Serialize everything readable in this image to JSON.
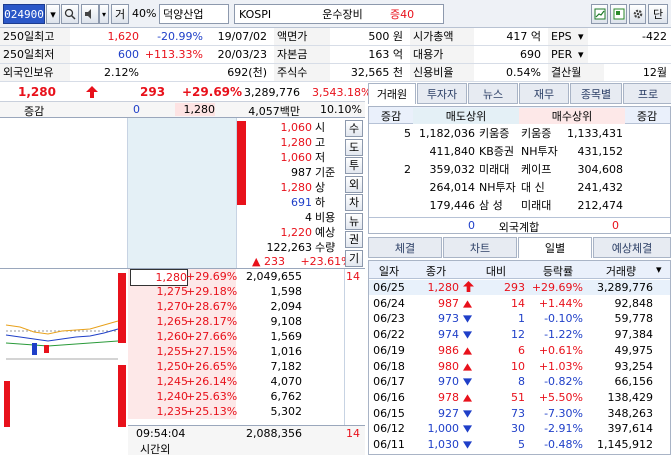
{
  "toolbar": {
    "code": "024900",
    "search_icon": "search-icon",
    "sound_icon": "speaker-icon",
    "geo_label": "거",
    "ratio": "40%",
    "stock_name": "덕양산업",
    "market": "KOSPI",
    "sector": "운수장비",
    "margin": "증40",
    "right_button": "단"
  },
  "info": {
    "row1": {
      "l1": "250일최고",
      "v1": "1,620",
      "p1": "-20.99%",
      "d1": "19/07/02",
      "l2": "액면가",
      "v2": "500 원",
      "l3": "시가총액",
      "v3": "417 억",
      "l4": "EPS",
      "v4": "-422"
    },
    "row2": {
      "l1": "250일최저",
      "v1": "600",
      "p1": "+113.33%",
      "d1": "20/03/23",
      "l2": "자본금",
      "v2": "163 억",
      "l3": "대용가",
      "v3": "690",
      "l4": "PER",
      "v4": ""
    },
    "row3": {
      "l1": "외국인보유",
      "v1": "2.12%",
      "d1": "692(천)",
      "l2": "주식수",
      "v2": "32,565 천",
      "l3": "신용비율",
      "v3": "0.54%",
      "l4": "결산월",
      "v4": "12월"
    }
  },
  "price": {
    "current": "1,280",
    "change": "293",
    "rate": "+29.69%",
    "volume": "3,289,776",
    "prev_volume": "3,543.18%"
  },
  "price2": {
    "label": "증감",
    "a": "0",
    "b": "1,280",
    "amount": "4,057백만",
    "ratio": "10.10%"
  },
  "sidebtns": [
    "수",
    "도",
    "투",
    "외",
    "차",
    "뉴",
    "권",
    "기"
  ],
  "stats": [
    {
      "v": "1,060",
      "l": "시",
      "c": "red"
    },
    {
      "v": "1,280",
      "l": "고",
      "c": "red"
    },
    {
      "v": "1,060",
      "l": "저",
      "c": "red"
    },
    {
      "v": "987",
      "l": "기준",
      "c": "black"
    },
    {
      "v": "1,280",
      "l": "상",
      "c": "red"
    },
    {
      "v": "691",
      "l": "하",
      "c": "blue"
    },
    {
      "v": "4",
      "l": "비용",
      "c": "black"
    },
    {
      "v": "1,220",
      "l": "예상",
      "c": "red"
    },
    {
      "v": "122,263",
      "l": "수량",
      "c": "black"
    }
  ],
  "expected": {
    "change": "233",
    "rate": "+23.61%"
  },
  "bids": [
    {
      "p": "1,280",
      "r": "+29.69%",
      "q": "2,049,655",
      "n": "14"
    },
    {
      "p": "1,275",
      "r": "+29.18%",
      "q": "1,598",
      "n": ""
    },
    {
      "p": "1,270",
      "r": "+28.67%",
      "q": "2,094",
      "n": ""
    },
    {
      "p": "1,265",
      "r": "+28.17%",
      "q": "9,108",
      "n": ""
    },
    {
      "p": "1,260",
      "r": "+27.66%",
      "q": "1,569",
      "n": ""
    },
    {
      "p": "1,255",
      "r": "+27.15%",
      "q": "1,016",
      "n": ""
    },
    {
      "p": "1,250",
      "r": "+26.65%",
      "q": "7,182",
      "n": ""
    },
    {
      "p": "1,245",
      "r": "+26.14%",
      "q": "4,070",
      "n": ""
    },
    {
      "p": "1,240",
      "r": "+25.63%",
      "q": "6,762",
      "n": ""
    },
    {
      "p": "1,235",
      "r": "+25.13%",
      "q": "5,302",
      "n": ""
    }
  ],
  "footer": {
    "time": "09:54:04",
    "label": "시간외",
    "total": "2,088,356",
    "n": "14"
  },
  "rtabs": [
    "거래원",
    "투자자",
    "뉴스",
    "재무",
    "종목별",
    "프로"
  ],
  "broker": {
    "headers": [
      "증감",
      "매도상위",
      "매수상위",
      "증감"
    ],
    "rows": [
      {
        "d1": "5",
        "sv": "1,182,036",
        "sn": "키움증",
        "bn": "키움증",
        "bv": "1,133,431",
        "d2": ""
      },
      {
        "d1": "",
        "sv": "411,840",
        "sn": "KB증권",
        "bn": "NH투자",
        "bv": "431,152",
        "d2": ""
      },
      {
        "d1": "2",
        "sv": "359,032",
        "sn": "미래대",
        "bn": "케이프",
        "bv": "304,608",
        "d2": ""
      },
      {
        "d1": "",
        "sv": "264,014",
        "sn": "NH투자",
        "bn": "대 신",
        "bv": "241,432",
        "d2": ""
      },
      {
        "d1": "",
        "sv": "179,446",
        "sn": "삼 성",
        "bn": "미래대",
        "bv": "212,474",
        "d2": ""
      }
    ],
    "foreign_label": "외국계합",
    "foreign_sell": "0",
    "foreign_buy": "0"
  },
  "btabs": [
    "체결",
    "차트",
    "일별",
    "예상체결"
  ],
  "daily": {
    "headers": [
      "일자",
      "종가",
      "대비",
      "등락률",
      "거래량"
    ],
    "rows": [
      {
        "d": "06/25",
        "c": "1,280",
        "a": "up",
        "ch": "293",
        "r": "+29.69%",
        "v": "3,289,776",
        "col": "red"
      },
      {
        "d": "06/24",
        "c": "987",
        "a": "tri-up",
        "ch": "14",
        "r": "+1.44%",
        "v": "92,848",
        "col": "red"
      },
      {
        "d": "06/23",
        "c": "973",
        "a": "tri-down",
        "ch": "1",
        "r": "-0.10%",
        "v": "59,778",
        "col": "blue"
      },
      {
        "d": "06/22",
        "c": "974",
        "a": "tri-down",
        "ch": "12",
        "r": "-1.22%",
        "v": "97,384",
        "col": "blue"
      },
      {
        "d": "06/19",
        "c": "986",
        "a": "tri-up",
        "ch": "6",
        "r": "+0.61%",
        "v": "49,975",
        "col": "red"
      },
      {
        "d": "06/18",
        "c": "980",
        "a": "tri-up",
        "ch": "10",
        "r": "+1.03%",
        "v": "93,254",
        "col": "red"
      },
      {
        "d": "06/17",
        "c": "970",
        "a": "tri-down",
        "ch": "8",
        "r": "-0.82%",
        "v": "66,156",
        "col": "blue"
      },
      {
        "d": "06/16",
        "c": "978",
        "a": "tri-up",
        "ch": "51",
        "r": "+5.50%",
        "v": "138,429",
        "col": "red"
      },
      {
        "d": "06/15",
        "c": "927",
        "a": "tri-down",
        "ch": "73",
        "r": "-7.30%",
        "v": "348,263",
        "col": "blue"
      },
      {
        "d": "06/12",
        "c": "1,000",
        "a": "tri-down",
        "ch": "30",
        "r": "-2.91%",
        "v": "397,614",
        "col": "blue"
      },
      {
        "d": "06/11",
        "c": "1,030",
        "a": "tri-down",
        "ch": "5",
        "r": "-0.48%",
        "v": "1,145,912",
        "col": "blue"
      }
    ]
  }
}
